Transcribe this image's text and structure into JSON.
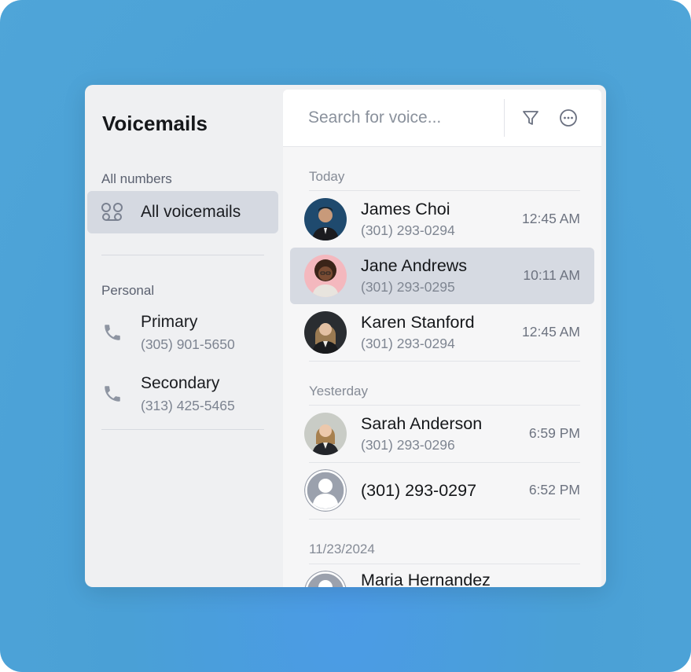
{
  "sidebar": {
    "title": "Voicemails",
    "all_numbers_label": "All numbers",
    "all_voicemails_label": "All voicemails",
    "personal_label": "Personal",
    "lines": [
      {
        "name": "Primary",
        "number": "(305) 901-5650"
      },
      {
        "name": "Secondary",
        "number": "(313) 425-5465"
      }
    ]
  },
  "search": {
    "placeholder": "Search for voice...",
    "value": ""
  },
  "sections": [
    {
      "label": "Today",
      "items": [
        {
          "name": "James Choi",
          "number": "(301) 293-0294",
          "time": "12:45 AM",
          "avatar": "photo-james"
        },
        {
          "name": "Jane Andrews",
          "number": "(301) 293-0295",
          "time": "10:11 AM",
          "avatar": "photo-jane"
        },
        {
          "name": "Karen Stanford",
          "number": "(301) 293-0294",
          "time": "12:45 AM",
          "avatar": "photo-karen"
        }
      ]
    },
    {
      "label": "Yesterday",
      "items": [
        {
          "name": "Sarah Anderson",
          "number": "(301) 293-0296",
          "time": "6:59 PM",
          "avatar": "photo-sarah"
        },
        {
          "name": "(301) 293-0297",
          "number": "",
          "time": "6:52 PM",
          "avatar": "default-user-icon"
        }
      ]
    },
    {
      "label": "11/23/2024",
      "items": [
        {
          "name": "Maria Hernandez",
          "number": "",
          "time": "",
          "avatar": "default-user-icon"
        }
      ]
    }
  ],
  "icons": {
    "voicemail": "voicemail-icon",
    "phone": "phone-icon",
    "filter": "filter-icon",
    "more": "more-icon"
  },
  "colors": {
    "background": "#4aa0d6",
    "selected_row": "#d6dae2",
    "active_nav": "#d5d9e1"
  }
}
